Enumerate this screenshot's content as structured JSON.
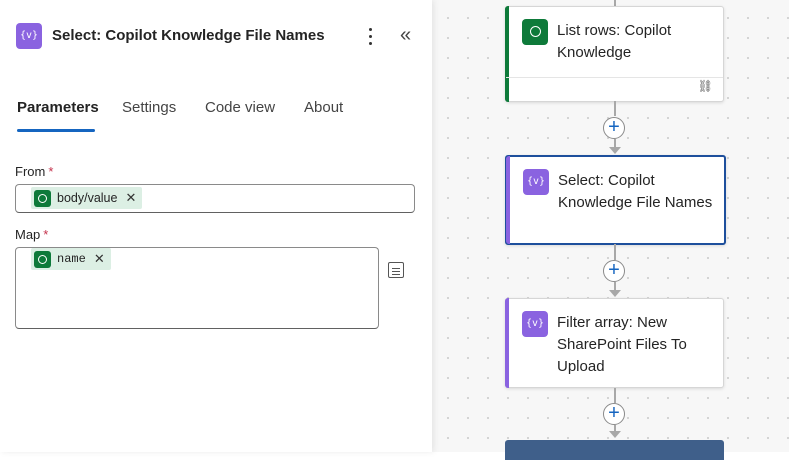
{
  "panel": {
    "title": "Select: Copilot Knowledge File Names",
    "icon": "{v}",
    "tabs": [
      {
        "label": "Parameters",
        "active": true
      },
      {
        "label": "Settings",
        "active": false
      },
      {
        "label": "Code view",
        "active": false
      },
      {
        "label": "About",
        "active": false
      }
    ],
    "fields": {
      "from": {
        "label": "From",
        "required": "*",
        "token": "body/value",
        "remove": "✕"
      },
      "map": {
        "label": "Map",
        "required": "*",
        "token": "name",
        "remove": "✕"
      }
    },
    "collapse_icon": "«"
  },
  "flow": {
    "cards": [
      {
        "title": "List rows: Copilot Knowledge",
        "icon": "dataverse-icon",
        "color": "#0e7a3a"
      },
      {
        "title": "Select: Copilot Knowledge File Names",
        "icon": "{v}",
        "color": "#8a63e0"
      },
      {
        "title": "Filter array: New SharePoint Files To Upload",
        "icon": "{v}",
        "color": "#8a63e0"
      }
    ],
    "add_symbol": "+"
  },
  "colors": {
    "accent": "#1565c0",
    "dataverse": "#0e7a3a",
    "data_ops": "#8a63e0",
    "selected_border": "#1e4f9c"
  }
}
